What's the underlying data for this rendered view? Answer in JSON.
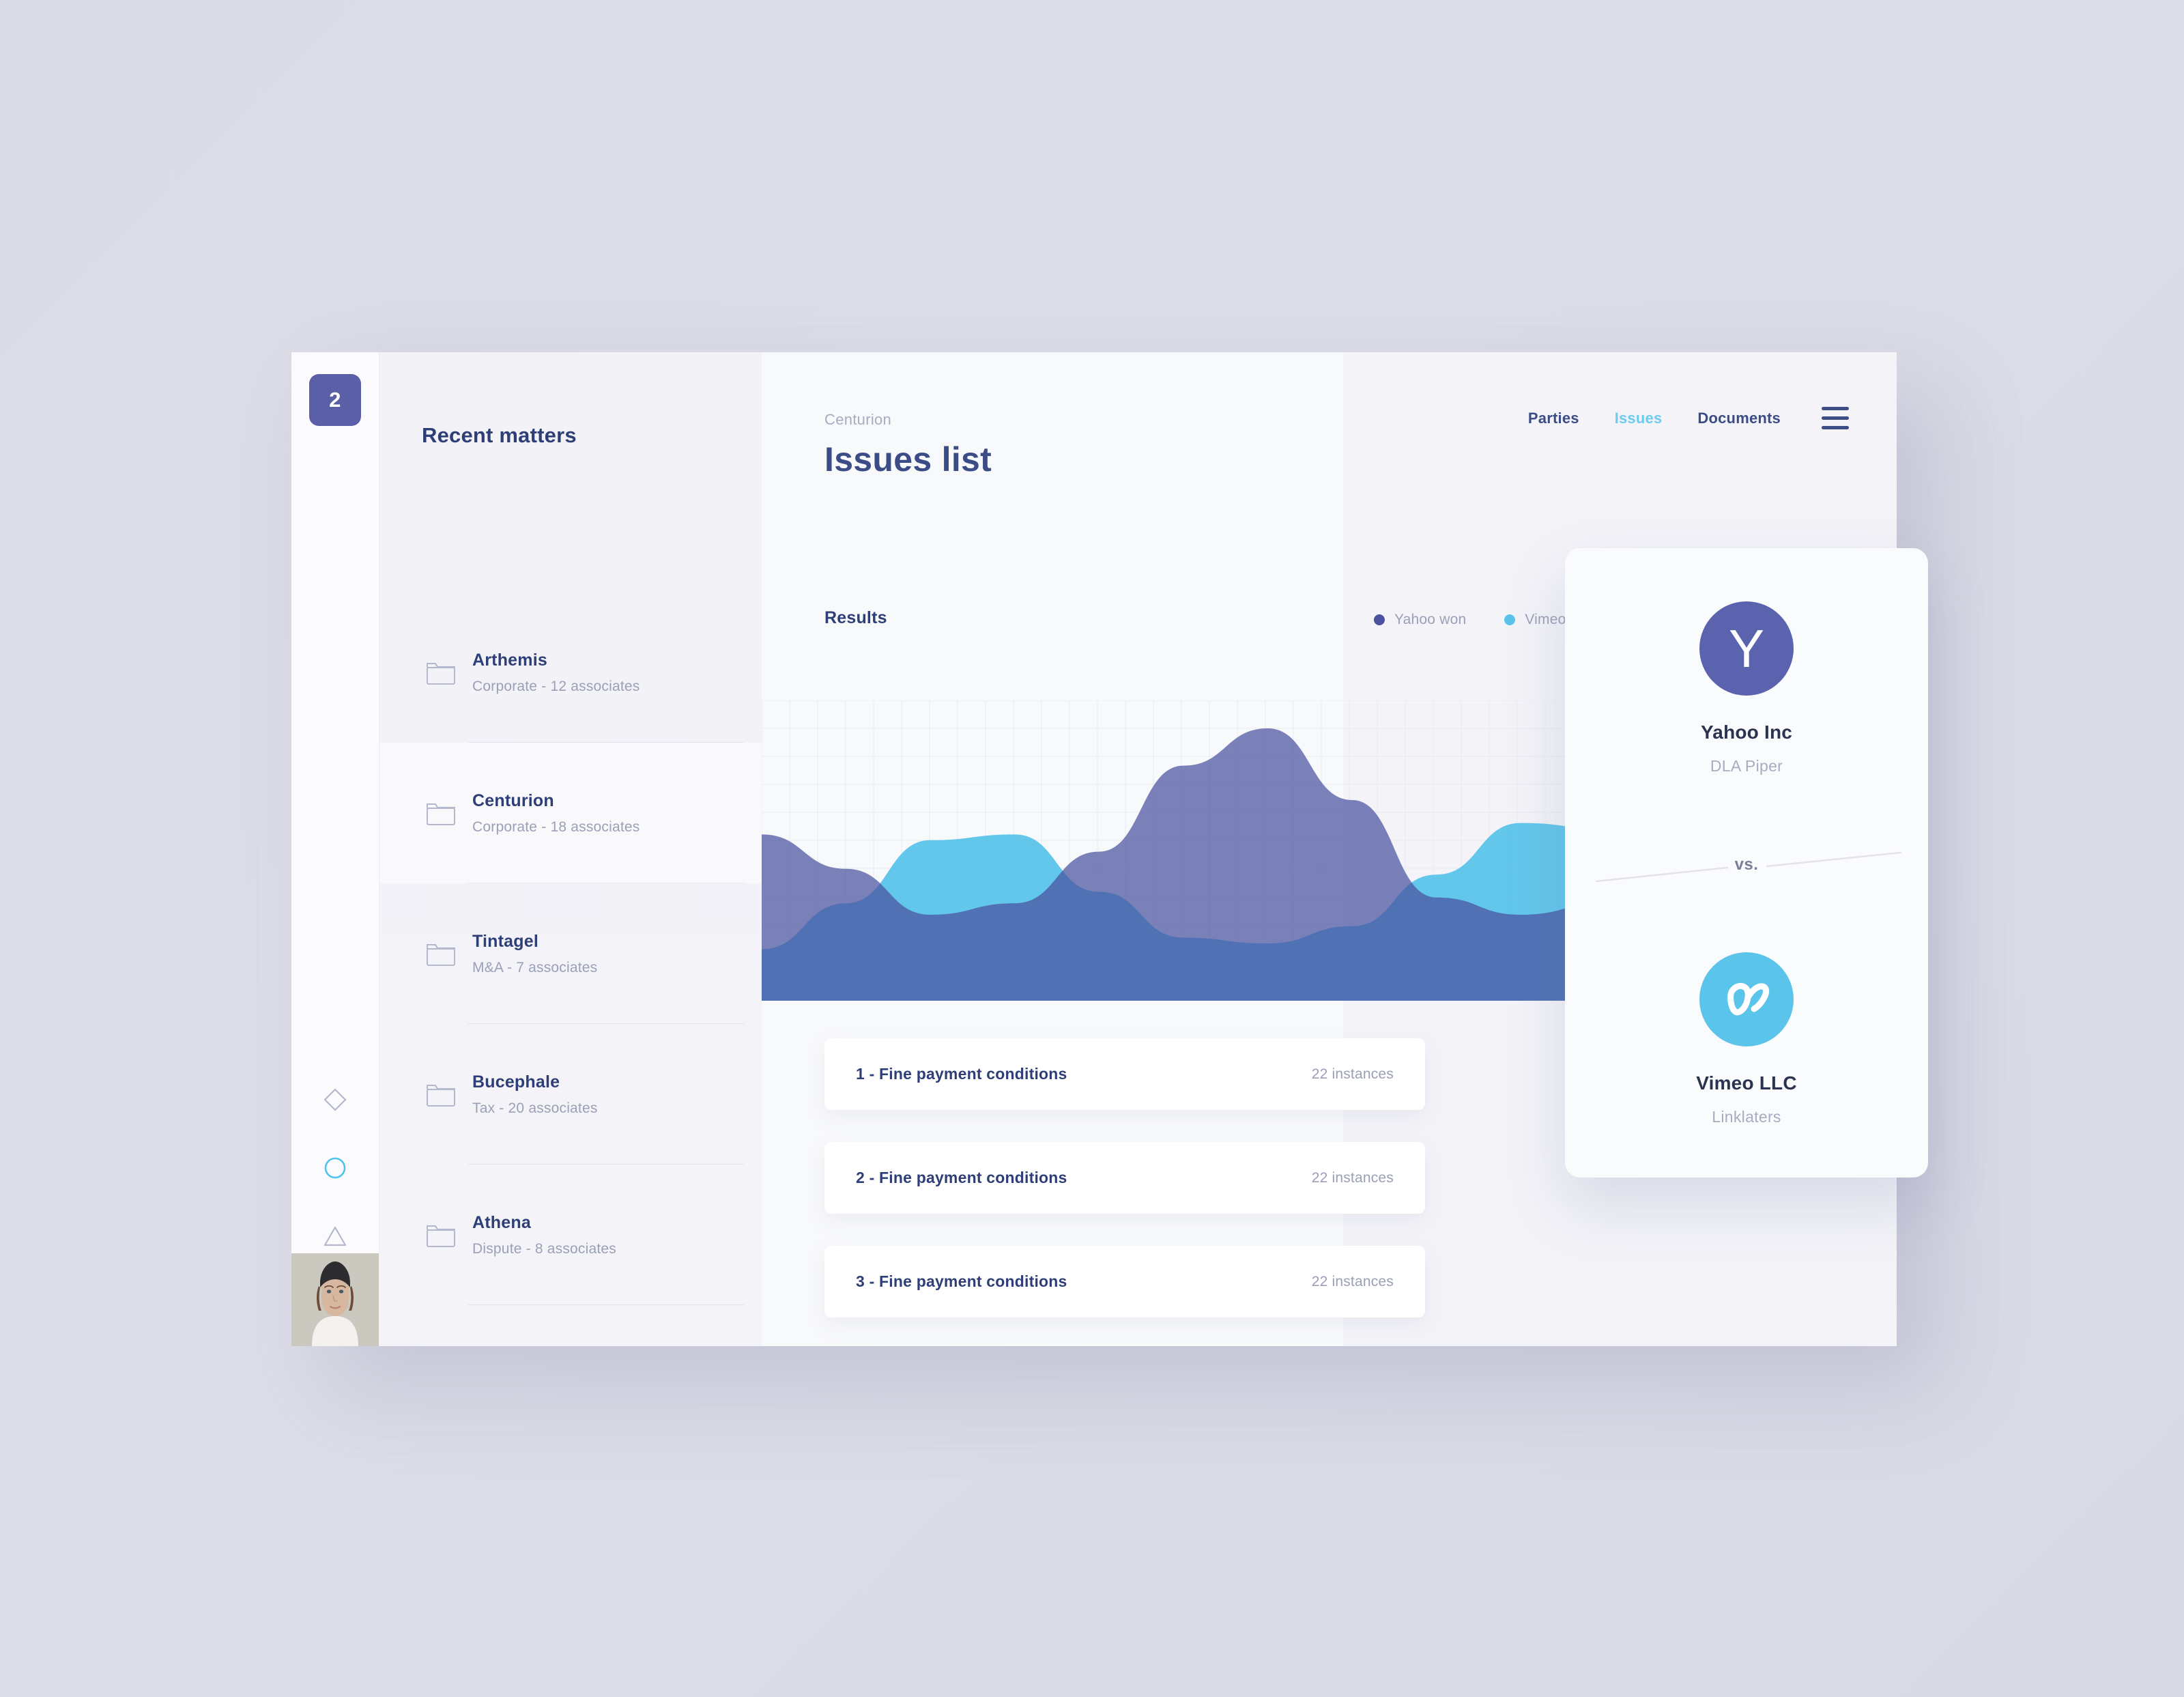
{
  "app": {
    "logo_badge": "2"
  },
  "rail": {
    "icons": [
      {
        "name": "diamond-icon",
        "active": false
      },
      {
        "name": "circle-icon",
        "active": true
      },
      {
        "name": "triangle-icon",
        "active": false
      },
      {
        "name": "close-icon",
        "active": false
      }
    ]
  },
  "matters": {
    "title": "Recent matters",
    "add_label": "+",
    "items": [
      {
        "name": "Arthemis",
        "meta": "Corporate - 12 associates"
      },
      {
        "name": "Centurion",
        "meta": "Corporate - 18 associates"
      },
      {
        "name": "Tintagel",
        "meta": "M&A - 7 associates"
      },
      {
        "name": "Bucephale",
        "meta": "Tax - 20 associates"
      },
      {
        "name": "Athena",
        "meta": "Dispute - 8 associates"
      }
    ]
  },
  "header": {
    "breadcrumb": "Centurion",
    "title": "Issues list",
    "nav": [
      {
        "label": "Parties",
        "active": false
      },
      {
        "label": "Issues",
        "active": true
      },
      {
        "label": "Documents",
        "active": false
      }
    ],
    "menu_icon": "hamburger-menu-icon"
  },
  "results": {
    "label": "Results",
    "legend": [
      {
        "label": "Yahoo won",
        "color": "#4a52a0"
      },
      {
        "label": "Vimeo won",
        "color": "#5bc4ea"
      }
    ]
  },
  "issues": [
    {
      "title": "1 - Fine payment conditions",
      "count": "22 instances"
    },
    {
      "title": "2 - Fine payment conditions",
      "count": "22 instances"
    },
    {
      "title": "3 - Fine payment conditions",
      "count": "22 instances"
    }
  ],
  "comparison": {
    "vs_label": "vs.",
    "top": {
      "logo_letter": "Y",
      "name": "Yahoo Inc",
      "firm": "DLA Piper",
      "color": "#5b62ae"
    },
    "bottom": {
      "logo_letter": "v",
      "name": "Vimeo LLC",
      "firm": "Linklaters",
      "color": "#5bc4ea"
    }
  },
  "chart_data": {
    "type": "area",
    "title": "Results",
    "xlabel": "",
    "ylabel": "",
    "grid": true,
    "legend_position": "top-right",
    "x": [
      0,
      1,
      2,
      3,
      4,
      5,
      6,
      7,
      8,
      9,
      10
    ],
    "ylim": [
      0,
      100
    ],
    "series": [
      {
        "name": "Yahoo won",
        "color": "#4a52a0",
        "opacity": 0.72,
        "values": [
          58,
          46,
          30,
          34,
          52,
          82,
          95,
          70,
          36,
          30,
          34
        ]
      },
      {
        "name": "Vimeo won",
        "color": "#5bc4ea",
        "opacity": 0.95,
        "values": [
          18,
          34,
          56,
          58,
          38,
          22,
          20,
          26,
          44,
          62,
          60
        ]
      }
    ]
  }
}
